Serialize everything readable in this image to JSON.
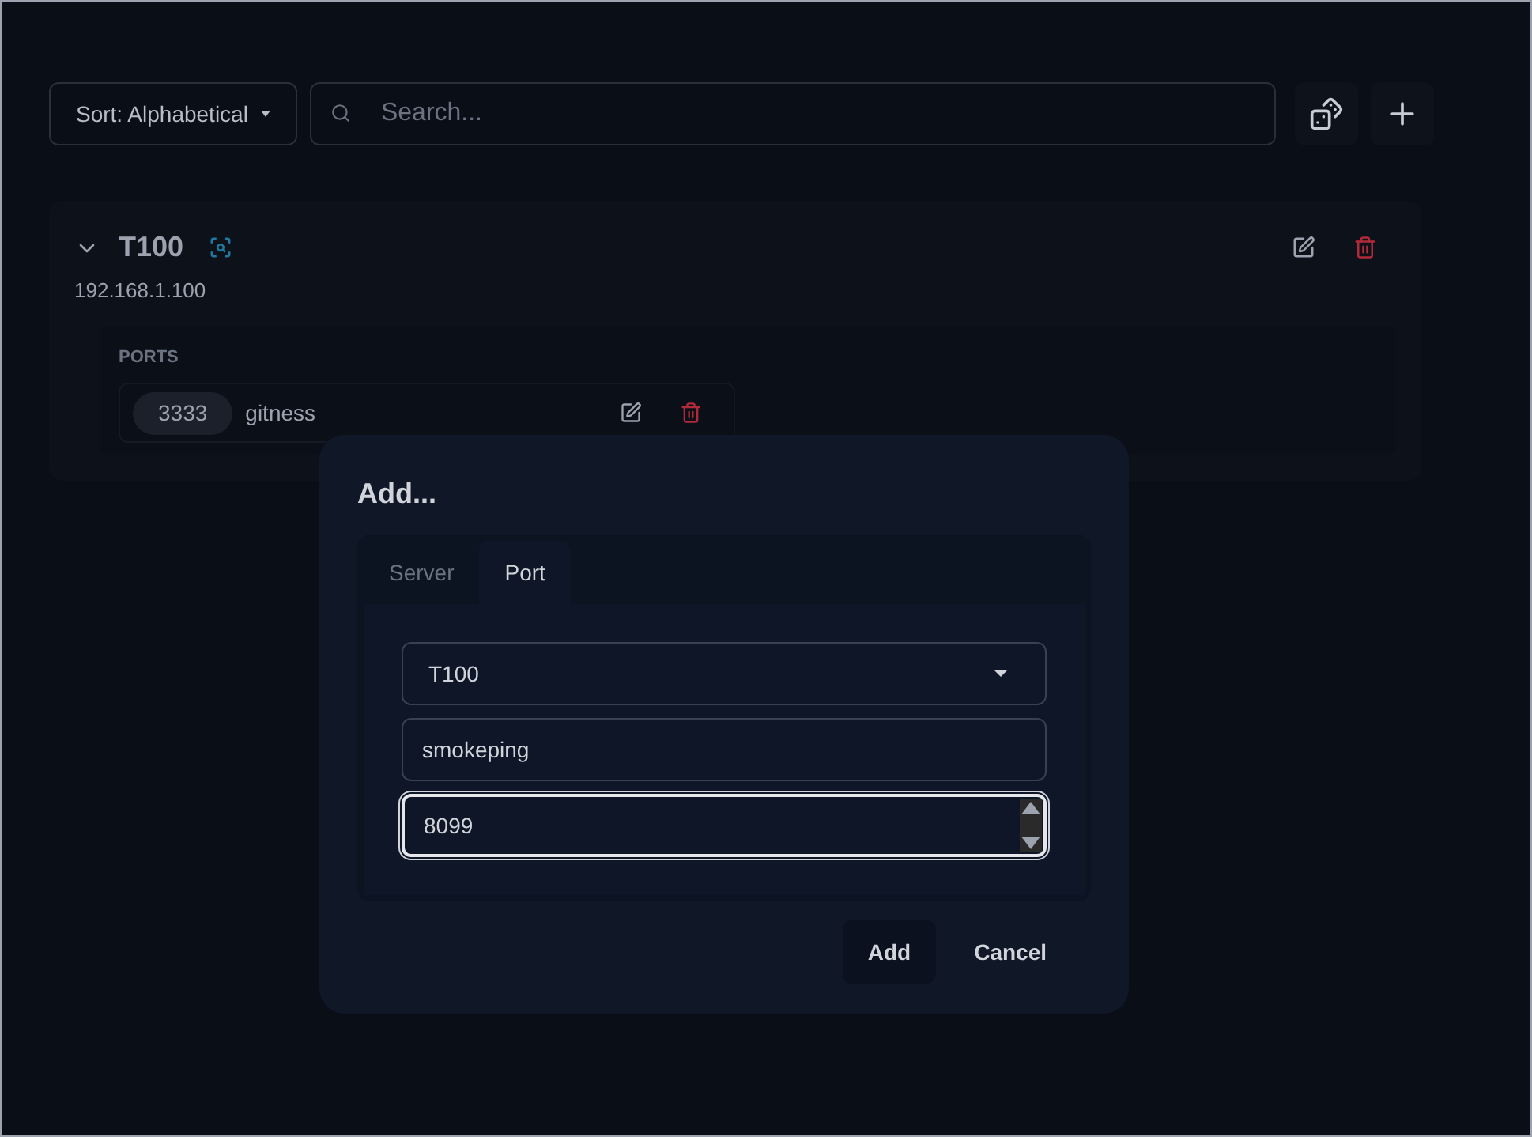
{
  "toolbar": {
    "sort": "Sort: Alphabetical",
    "search": {
      "placeholder": "Search..."
    }
  },
  "servers": [
    {
      "name": "T100",
      "address": "192.168.1.100",
      "expanded": true,
      "ports_heading": "PORTS",
      "ports": [
        {
          "number": "3333",
          "name": "gitness"
        }
      ]
    }
  ],
  "dialog": {
    "title": "Add...",
    "tabs": [
      {
        "label": "Server",
        "selected": false
      },
      {
        "label": "Port",
        "selected": true
      }
    ],
    "server_select": "T100",
    "name_value": "smokeping",
    "port_value": "8099",
    "buttons": [
      {
        "label": "Add",
        "kind": "primary"
      },
      {
        "label": "Cancel",
        "kind": "plain"
      }
    ]
  }
}
